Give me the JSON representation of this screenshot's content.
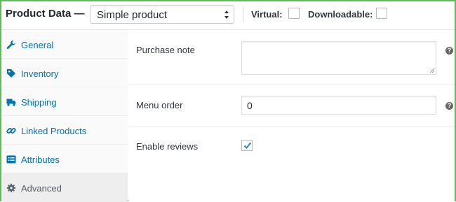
{
  "header": {
    "title": "Product Data —",
    "product_type": {
      "selected": "Simple product"
    },
    "virtual_label": "Virtual:",
    "downloadable_label": "Downloadable:",
    "virtual_checked": false,
    "downloadable_checked": false
  },
  "sidebar": {
    "items": [
      {
        "label": "General",
        "icon": "wrench-icon"
      },
      {
        "label": "Inventory",
        "icon": "tag-icon"
      },
      {
        "label": "Shipping",
        "icon": "truck-icon"
      },
      {
        "label": "Linked Products",
        "icon": "link-icon"
      },
      {
        "label": "Attributes",
        "icon": "list-icon"
      },
      {
        "label": "Advanced",
        "icon": "gear-icon",
        "active": true
      }
    ]
  },
  "main": {
    "purchase_note": {
      "label": "Purchase note",
      "value": ""
    },
    "menu_order": {
      "label": "Menu order",
      "value": "0"
    },
    "enable_reviews": {
      "label": "Enable reviews",
      "checked": true
    },
    "help_glyph": "?"
  },
  "colors": {
    "link": "#0073aa",
    "border_accent": "#62b85a",
    "active_tab_bg": "#eeeeee"
  }
}
